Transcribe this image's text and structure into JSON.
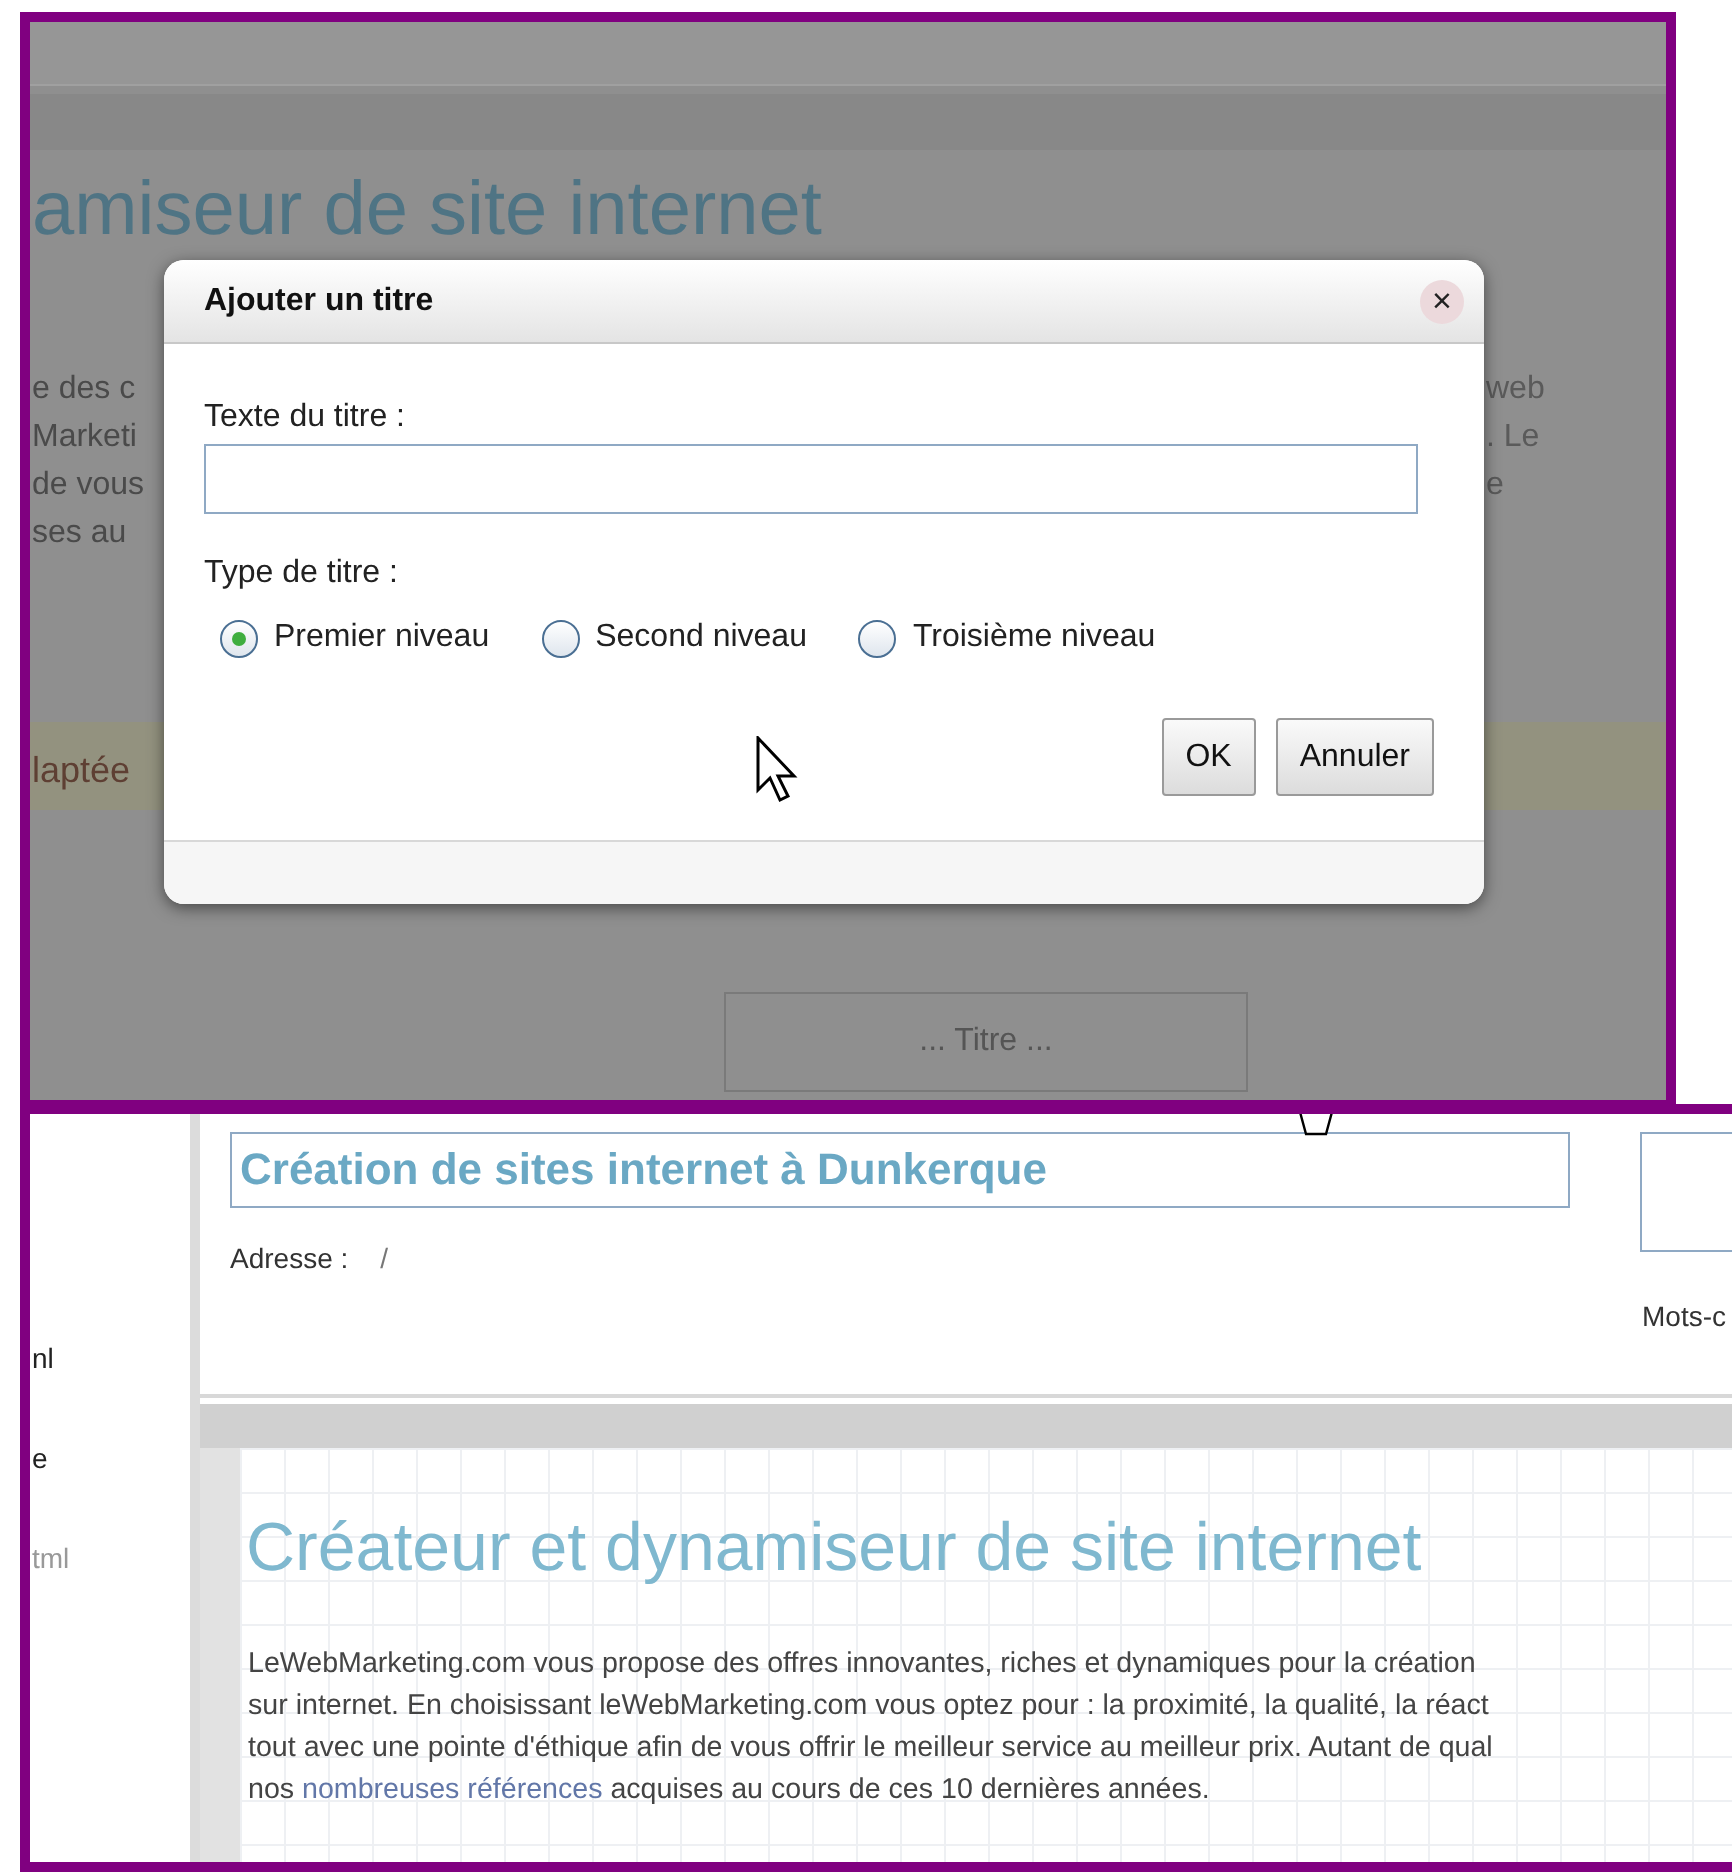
{
  "background_editor": {
    "heading_fragment": "amiseur de site internet",
    "left_fragments": [
      "e des c",
      "Marketi",
      "de vous",
      "ses au"
    ],
    "right_fragments": [
      "web",
      ". Le",
      "e"
    ],
    "notice_fragment": "laptée",
    "title_placeholder_box": "... Titre ..."
  },
  "dialog": {
    "title": "Ajouter un titre",
    "close": "×",
    "text_label": "Texte du titre :",
    "type_label": "Type de titre :",
    "options": [
      {
        "label": "Premier niveau",
        "selected": true
      },
      {
        "label": "Second niveau",
        "selected": false
      },
      {
        "label": "Troisième niveau",
        "selected": false
      }
    ],
    "buttons": [
      "OK",
      "Annuler"
    ]
  },
  "page_editor": {
    "sidebar_fragments": [
      "nl",
      "e",
      "tml"
    ],
    "page_title": "Création de sites internet à Dunkerque",
    "address_label": "Adresse :",
    "address_value": "/",
    "keywords_label": "Mots-c",
    "heading": "Créateur et dynamiseur de site internet",
    "paragraph_lines": [
      "LeWebMarketing.com vous propose des offres innovantes, riches et dynamiques pour la création",
      "sur internet. En choisissant leWebMarketing.com vous optez pour : la proximité, la qualité, la réact",
      "tout avec une pointe d'éthique afin de vous offrir le meilleur service au meilleur prix. Autant de qual"
    ],
    "last_line": {
      "before": "nos ",
      "link": "nombreuses références",
      "after": " acquises au cours de ces 10 dernières années."
    }
  }
}
